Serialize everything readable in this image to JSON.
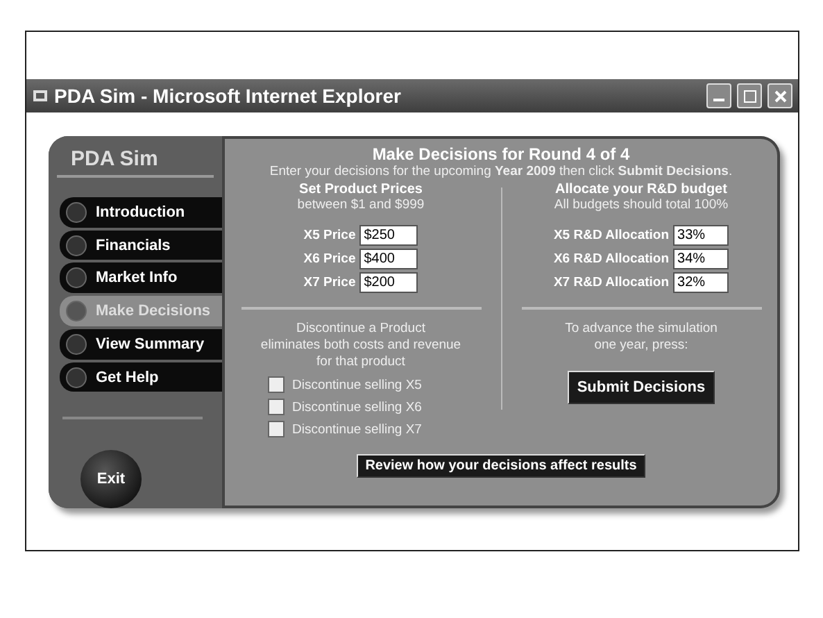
{
  "window": {
    "title": "PDA Sim - Microsoft Internet Explorer"
  },
  "sidebar": {
    "title": "PDA Sim",
    "items": [
      {
        "label": "Introduction",
        "selected": false
      },
      {
        "label": "Financials",
        "selected": false
      },
      {
        "label": "Market Info",
        "selected": false
      },
      {
        "label": "Make Decisions",
        "selected": true
      },
      {
        "label": "View Summary",
        "selected": false
      },
      {
        "label": "Get Help",
        "selected": false
      }
    ],
    "exit": "Exit"
  },
  "header": {
    "title": "Make Decisions for Round 4 of 4",
    "instructions": "Enter your decisions for the upcoming **Year 2009** then click **Submit Decisions**."
  },
  "prices": {
    "heading": "Set Product Prices",
    "subheading": "between $1 and $999",
    "rows": [
      {
        "label": "X5 Price",
        "value": "$250"
      },
      {
        "label": "X6 Price",
        "value": "$400"
      },
      {
        "label": "X7 Price",
        "value": "$200"
      }
    ]
  },
  "budget": {
    "heading": "Allocate your R&D budget",
    "subheading": "All budgets should total 100%",
    "rows": [
      {
        "label": "X5 R&D Allocation",
        "value": "33%"
      },
      {
        "label": "X6 R&D Allocation",
        "value": "34%"
      },
      {
        "label": "X7 R&D Allocation",
        "value": "32%"
      }
    ]
  },
  "discontinue": {
    "heading": "Discontinue a Product",
    "lines": [
      "eliminates both costs and revenue",
      "for that product"
    ],
    "options": [
      {
        "label": "Discontinue selling X5",
        "checked": false
      },
      {
        "label": "Discontinue selling X6",
        "checked": false
      },
      {
        "label": "Discontinue selling X7",
        "checked": false
      }
    ]
  },
  "advance": {
    "lines": [
      "To advance the simulation",
      "one year, press:"
    ],
    "button": "Submit Decisions"
  },
  "review_button": "Review how your decisions affect results"
}
